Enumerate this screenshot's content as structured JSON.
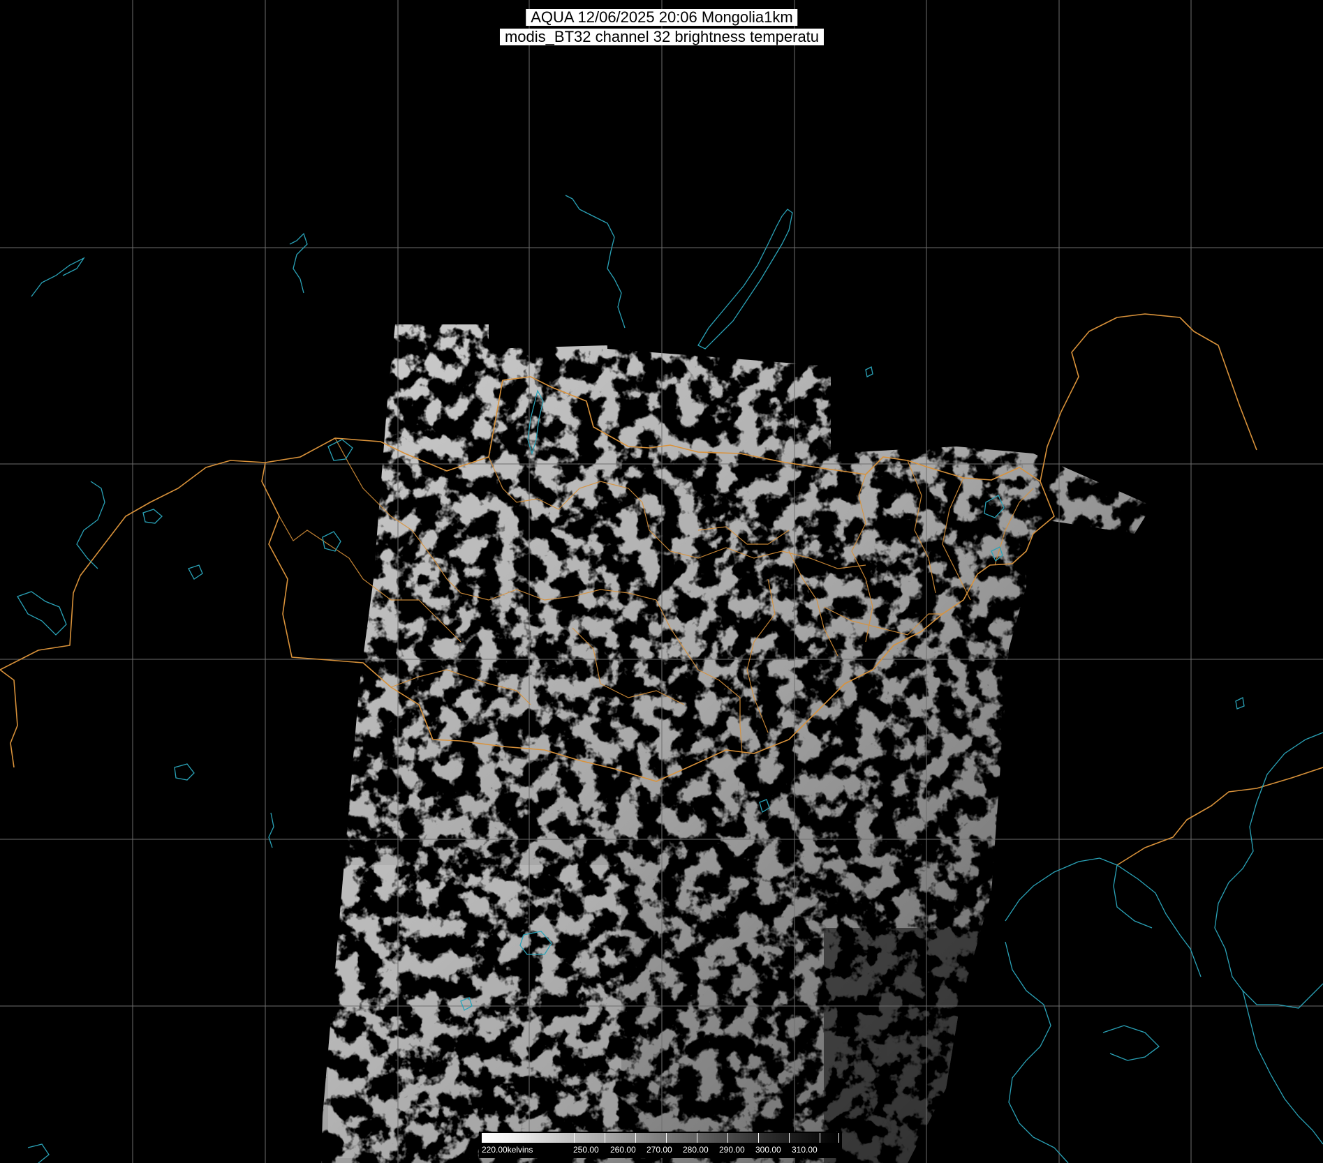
{
  "header": {
    "line1": "AQUA 12/06/2025 20:06 Mongolia1km",
    "line2": "modis_BT32 channel 32 brightness temperatu"
  },
  "colorbar": {
    "labels": [
      "220.00kelvins",
      "250.00",
      "260.00",
      "270.00",
      "280.00",
      "290.00",
      "300.00",
      "310.00"
    ]
  },
  "colors": {
    "background": "#000000",
    "grid": "#6e6e6e",
    "borders": "#d9923a",
    "water": "#2aa3b8"
  },
  "legend_items": [
    "image-swath",
    "lat-lon-grid",
    "country-borders",
    "province-borders",
    "coastlines-lakes-rivers"
  ]
}
